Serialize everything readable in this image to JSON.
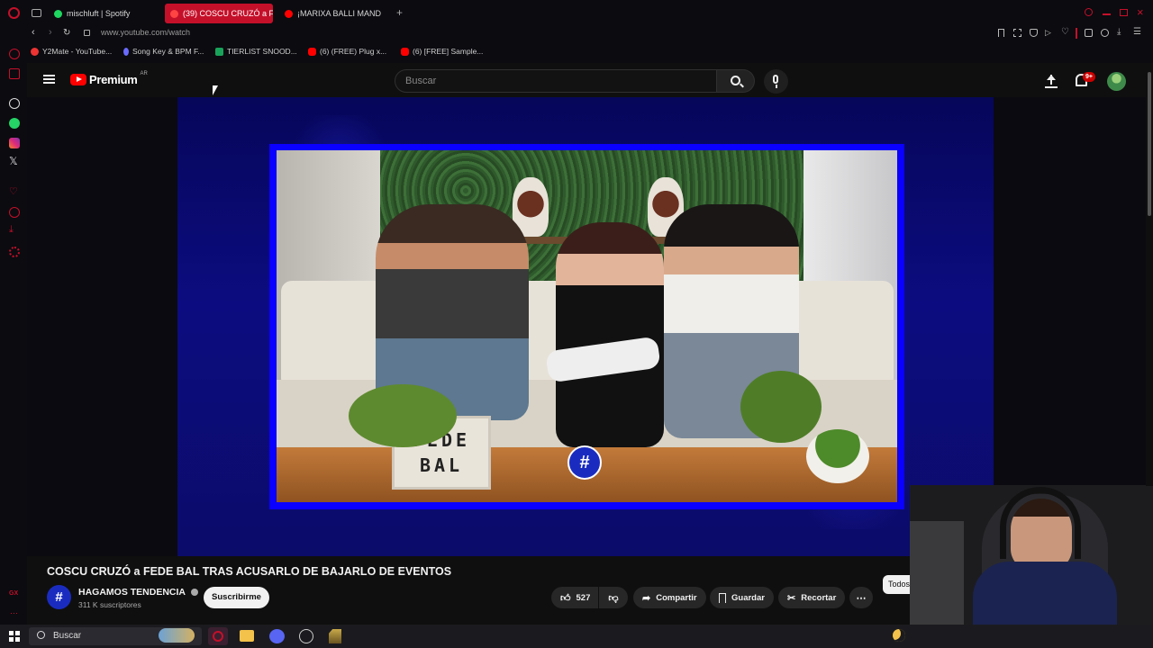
{
  "browser": {
    "tabs": [
      {
        "label": "mischluft | Spotify",
        "icon": "spotify-icon",
        "color": "#1ed760"
      },
      {
        "label": "(39) COSCU CRUZÓ a FE",
        "icon": "youtube-icon",
        "color": "#ff0000",
        "active": true
      },
      {
        "label": "¡MARIXA BALLI MAND",
        "icon": "youtube-icon",
        "color": "#ff0000"
      }
    ],
    "url": "www.youtube.com/watch",
    "bookmarks": [
      {
        "label": "Y2Mate - YouTube...",
        "color": "#e33"
      },
      {
        "label": "Song Key & BPM F...",
        "color": "#6a6aff"
      },
      {
        "label": "TIERLIST SNOOD...",
        "color": "#19a35a"
      },
      {
        "label": "(6) (FREE) Plug x...",
        "color": "#ff0000"
      },
      {
        "label": "(6) [FREE] Sample...",
        "color": "#ff0000"
      }
    ]
  },
  "youtube": {
    "logo_text": "Premium",
    "country_code": "AR",
    "search_placeholder": "Buscar",
    "notification_badge": "9+"
  },
  "video": {
    "title": "COSCU CRUZÓ a FEDE BAL TRAS ACUSARLO DE BAJARLO DE EVENTOS",
    "lightbox_line1": "FEDE",
    "lightbox_line2": "BAL",
    "channel_name": "HAGAMOS TENDENCIA",
    "subscribers": "311 K suscriptores",
    "subscribe_label": "Suscribirme",
    "likes": "527",
    "share_label": "Compartir",
    "save_label": "Guardar",
    "clip_label": "Recortar",
    "chip_label": "Todos"
  },
  "taskbar": {
    "search_placeholder": "Buscar"
  },
  "colors": {
    "accent": "#ff0000",
    "tab_active": "#c5102a",
    "frame_blue": "#0a00ff"
  }
}
